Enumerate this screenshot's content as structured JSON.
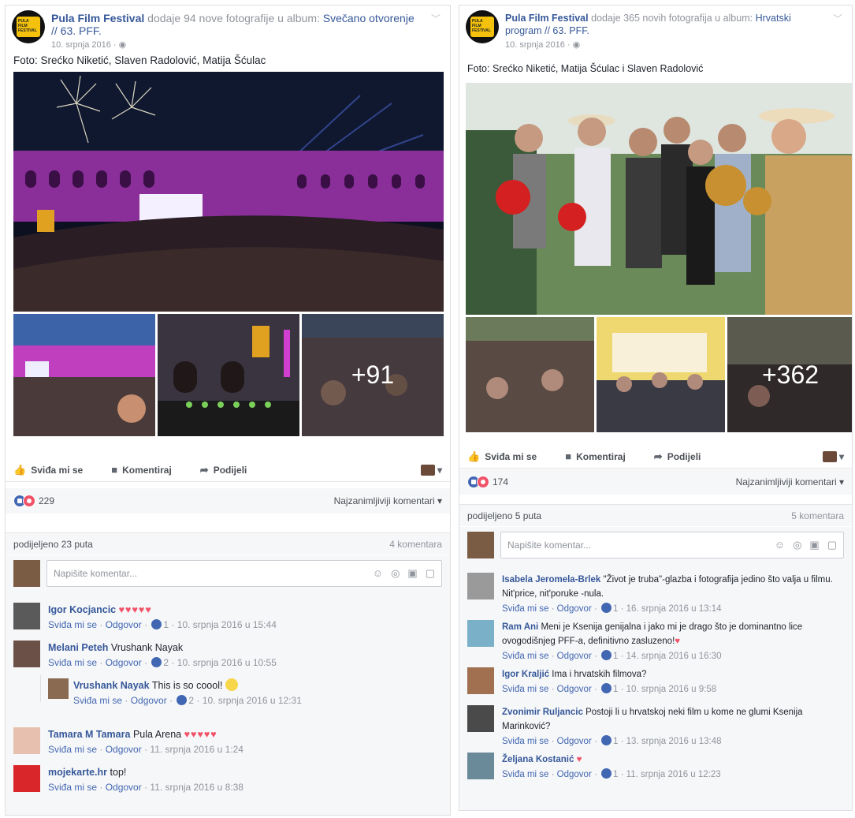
{
  "left_post": {
    "page_name": "Pula Film Festival",
    "action_text": "dodaje 94 nove fotografije u album:",
    "album": "Svečano otvorenje // 63. PFF.",
    "date": "10. srpnja 2016 ·",
    "caption": "Foto: Srećko Niketić, Slaven Radolović, Matija Šćulac",
    "more_photos": "+91",
    "actions": {
      "like": "Sviđa mi se",
      "comment": "Komentiraj",
      "share": "Podijeli"
    },
    "reaction_count": "229",
    "sort_label": "Najzanimljiviji komentari",
    "shares": "podijeljeno 23 puta",
    "comment_count": "4 komentara",
    "composer_placeholder": "Napišite komentar...",
    "comments": [
      {
        "author": "Igor Kocjancic",
        "text": "",
        "hearts": "♥♥♥♥♥",
        "like": "Sviđa mi se",
        "reply": "Odgovor",
        "likes": "1",
        "time": "10. srpnja 2016 u 15:44"
      },
      {
        "author": "Melani Peteh",
        "text": "Vrushank Nayak",
        "like": "Sviđa mi se",
        "reply": "Odgovor",
        "likes": "2",
        "time": "10. srpnja 2016 u 10:55"
      },
      {
        "author": "Vrushank Nayak",
        "text": "This is so coool!",
        "like": "Sviđa mi se",
        "reply": "Odgovor",
        "likes": "2",
        "time": "10. srpnja 2016 u 12:31"
      },
      {
        "author": "Tamara M Tamara",
        "text": "Pula Arena",
        "hearts": "♥♥♥♥♥",
        "like": "Sviđa mi se",
        "reply": "Odgovor",
        "time": "11. srpnja 2016 u 1:24"
      },
      {
        "author": "mojekarte.hr",
        "text": "top!",
        "like": "Sviđa mi se",
        "reply": "Odgovor",
        "time": "11. srpnja 2016 u 8:38"
      }
    ]
  },
  "right_post": {
    "page_name": "Pula Film Festival",
    "action_text": "dodaje 365 novih fotografija u album:",
    "album": "Hrvatski program // 63. PFF.",
    "date": "10. srpnja 2016 ·",
    "caption": "Foto: Srećko Niketić, Matija Šćulac i Slaven Radolović",
    "more_photos": "+362",
    "actions": {
      "like": "Sviđa mi se",
      "comment": "Komentiraj",
      "share": "Podijeli"
    },
    "reaction_count": "174",
    "sort_label": "Najzanimljiviji komentari",
    "shares": "podijeljeno 5 puta",
    "comment_count": "5 komentara",
    "composer_placeholder": "Napišite komentar...",
    "comments": [
      {
        "author": "Isabela Jeromela-Brlek",
        "text": "\"Život je truba\"-glazba i fotografija jedino što valja u filmu. Nit'price, nit'poruke -nula.",
        "like": "Sviđa mi se",
        "reply": "Odgovor",
        "likes": "1",
        "time": "16. srpnja 2016 u 13:14"
      },
      {
        "author": "Ram Ani",
        "text": "Meni je Ksenija genijalna i jako mi je drago što je dominantno lice ovogodišnjeg PFF-a, definitivno zasluzeno!",
        "hearts": "♥",
        "like": "Sviđa mi se",
        "reply": "Odgovor",
        "likes": "1",
        "time": "14. srpnja 2016 u 16:30"
      },
      {
        "author": "Igor Kraljić",
        "text": "Ima i hrvatskih filmova?",
        "like": "Sviđa mi se",
        "reply": "Odgovor",
        "likes": "1",
        "time": "10. srpnja 2016 u 9:58"
      },
      {
        "author": "Zvonimir Ruljancic",
        "text": "Postoji li u hrvatskoj neki film u kome ne glumi Ksenija Marinković?",
        "like": "Sviđa mi se",
        "reply": "Odgovor",
        "likes": "1",
        "time": "13. srpnja 2016 u 13:48"
      },
      {
        "author": "Željana Kostanić",
        "text": "",
        "hearts": "♥",
        "like": "Sviđa mi se",
        "reply": "Odgovor",
        "likes": "1",
        "time": "11. srpnja 2016 u 12:23"
      }
    ]
  }
}
